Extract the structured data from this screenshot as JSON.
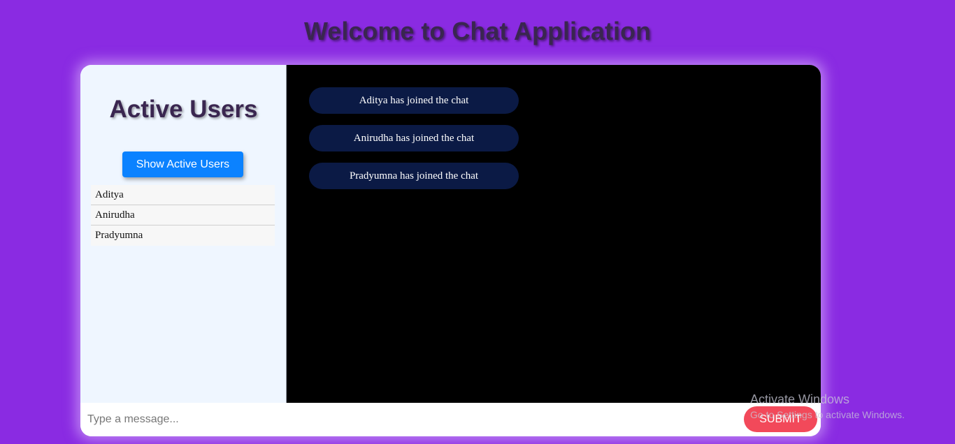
{
  "page": {
    "title": "Welcome to Chat Application"
  },
  "sidebar": {
    "title": "Active Users",
    "show_button_label": "Show Active Users",
    "users": [
      "Aditya",
      "Anirudha",
      "Pradyumna"
    ]
  },
  "messages": [
    "Aditya has joined the chat",
    "Anirudha has joined the chat",
    "Pradyumna has joined the chat"
  ],
  "composer": {
    "placeholder": "Type a message...",
    "value": "",
    "submit_label": "SUBMIT"
  },
  "watermark": {
    "title": "Activate Windows",
    "subtitle": "Go to Settings to activate Windows."
  },
  "colors": {
    "background": "#8a2be2",
    "sidebar_bg": "#eff6ff",
    "chat_bg": "#000000",
    "message_bubble": "#0b1a45",
    "primary_button": "#0b82ff",
    "submit_button": "#f2495a"
  }
}
